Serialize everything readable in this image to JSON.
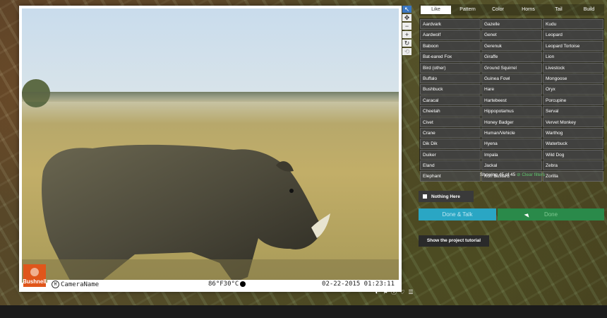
{
  "viewer": {
    "camera_name": "CameraName",
    "temperature": "86°F30°C",
    "datetime": "02-22-2015 01:23:11",
    "logo_text": "Bushnell"
  },
  "side_tools": [
    "pointer-icon",
    "move-icon",
    "zoom-out-icon",
    "zoom-in-icon",
    "rotate-icon",
    "reset-icon"
  ],
  "bottom_tools": [
    "contrast-icon",
    "flag-icon",
    "info-icon",
    "favorite-icon",
    "collection-icon"
  ],
  "tabs": [
    "Like",
    "Pattern",
    "Color",
    "Horns",
    "Tail",
    "Build"
  ],
  "active_tab": "Like",
  "species": [
    [
      "Aardvark",
      "Gazelle",
      "Kudu"
    ],
    [
      "Aardwolf",
      "Genet",
      "Leopard"
    ],
    [
      "Baboon",
      "Gerenuk",
      "Leopard Tortoise"
    ],
    [
      "Bat-eared Fox",
      "Giraffe",
      "Lion"
    ],
    [
      "Bird (other)",
      "Ground Squirrel",
      "Livestock"
    ],
    [
      "Buffalo",
      "Guinea Fowl",
      "Mongoose"
    ],
    [
      "Bushbuck",
      "Hare",
      "Oryx"
    ],
    [
      "Caracal",
      "Hartebeest",
      "Porcupine"
    ],
    [
      "Cheetah",
      "Hippopotamus",
      "Serval"
    ],
    [
      "Civet",
      "Honey Badger",
      "Vervet Monkey"
    ],
    [
      "Crane",
      "Human/Vehicle",
      "Warthog"
    ],
    [
      "Dik Dik",
      "Hyena",
      "Waterbuck"
    ],
    [
      "Duiker",
      "Impala",
      "Wild Dog"
    ],
    [
      "Eland",
      "Jackal",
      "Zebra"
    ],
    [
      "Elephant",
      "Kori Bustard",
      "Zorilla"
    ]
  ],
  "showing_text": "Showing 45 of 45",
  "clear_filters": "Clear filters",
  "nothing_here": "Nothing Here",
  "done_talk": "Done & Talk",
  "done": "Done",
  "tutorial": "Show the project tutorial"
}
